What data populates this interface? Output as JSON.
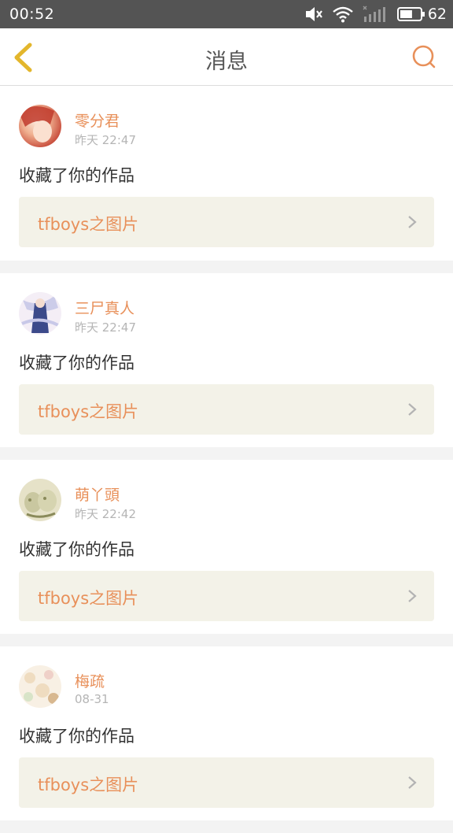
{
  "status_bar": {
    "time": "00:52",
    "battery_level": "62",
    "icons": [
      "mute-icon",
      "wifi-icon",
      "signal-icon",
      "battery-icon"
    ]
  },
  "header": {
    "title": "消息",
    "back_icon": "chevron-left-icon",
    "search_icon": "search-icon",
    "accent_color": "#e8905a",
    "back_color": "#e3b62c"
  },
  "messages": [
    {
      "username": "零分君",
      "timestamp": "昨天 22:47",
      "action": "收藏了你的作品",
      "work_title": "tfboys之图片",
      "avatar_colors": [
        "#c0392b",
        "#f0b090",
        "#fbe8dc"
      ]
    },
    {
      "username": "三尸真人",
      "timestamp": "昨天 22:47",
      "action": "收藏了你的作品",
      "work_title": "tfboys之图片",
      "avatar_colors": [
        "#3c4a8a",
        "#c8c8e8",
        "#f4eef6"
      ]
    },
    {
      "username": "萌丫頭",
      "timestamp": "昨天 22:42",
      "action": "收藏了你的作品",
      "work_title": "tfboys之图片",
      "avatar_colors": [
        "#8a8a5a",
        "#c9c7a0",
        "#e6e2c8"
      ]
    },
    {
      "username": "梅疏",
      "timestamp": "08-31",
      "action": "收藏了你的作品",
      "work_title": "tfboys之图片",
      "avatar_colors": [
        "#d8b890",
        "#efdcc0",
        "#f8f0e4"
      ]
    }
  ]
}
